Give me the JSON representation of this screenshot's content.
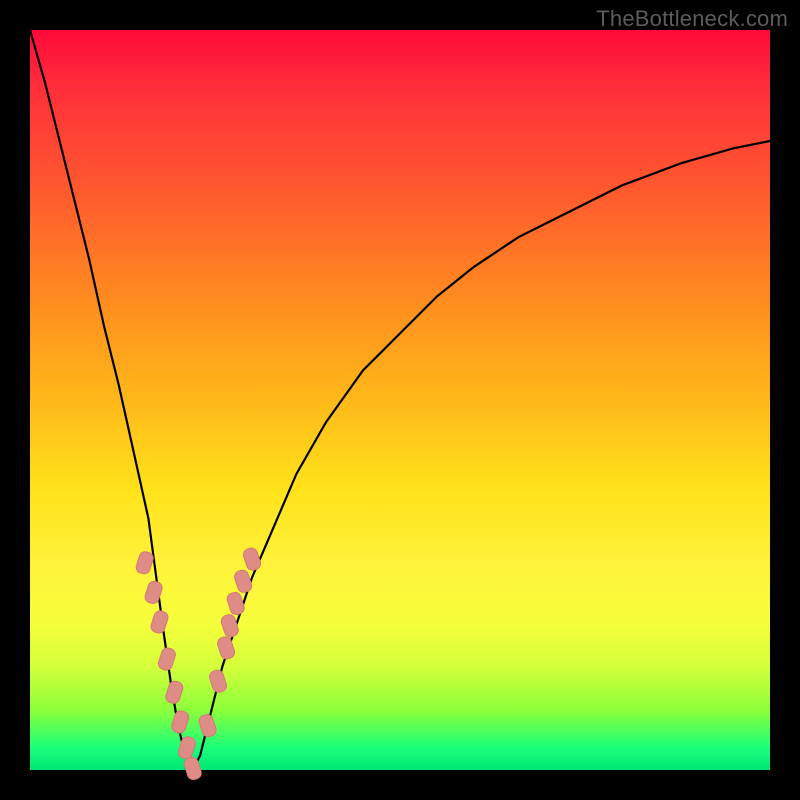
{
  "watermark": "TheBottleneck.com",
  "colors": {
    "frame": "#000000",
    "watermark": "#5c5c5c",
    "curve": "#000000",
    "marker_fill": "#e08c86",
    "gradient_top": "#ff0a3a",
    "gradient_bottom": "#00e676"
  },
  "chart_data": {
    "type": "line",
    "title": "",
    "xlabel": "",
    "ylabel": "",
    "xlim": [
      0,
      100
    ],
    "ylim": [
      0,
      100
    ],
    "grid": false,
    "legend": false,
    "notes": "Background vertical gradient red→green implies best (green) near y=0 at bottom. V-shaped bottleneck curve with minimum around x≈22. Estimated from pixel positions; no axis ticks in source image.",
    "series": [
      {
        "name": "left-branch",
        "x": [
          0,
          2,
          4,
          6,
          8,
          10,
          12,
          14,
          16,
          18,
          19,
          20,
          21,
          22
        ],
        "y": [
          100,
          93,
          85,
          77,
          69,
          60,
          52,
          43,
          34,
          19,
          12,
          6,
          2,
          0
        ]
      },
      {
        "name": "right-branch",
        "x": [
          22,
          23,
          24,
          26,
          28,
          30,
          33,
          36,
          40,
          45,
          50,
          55,
          60,
          66,
          72,
          80,
          88,
          95,
          100
        ],
        "y": [
          0,
          2,
          6,
          14,
          20,
          26,
          33,
          40,
          47,
          54,
          59,
          64,
          68,
          72,
          75,
          79,
          82,
          84,
          85
        ]
      }
    ],
    "markers": {
      "name": "highlighted-points",
      "shape": "rounded-rect",
      "x": [
        15.5,
        16.7,
        17.5,
        18.5,
        19.5,
        20.3,
        21.2,
        22.0,
        24.0,
        25.4,
        26.5,
        27.0,
        27.8,
        28.8,
        30.0
      ],
      "y": [
        28.0,
        24.0,
        20.0,
        15.0,
        10.5,
        6.5,
        3.0,
        0.2,
        6.0,
        12.0,
        16.5,
        19.5,
        22.5,
        25.5,
        28.5
      ]
    }
  }
}
